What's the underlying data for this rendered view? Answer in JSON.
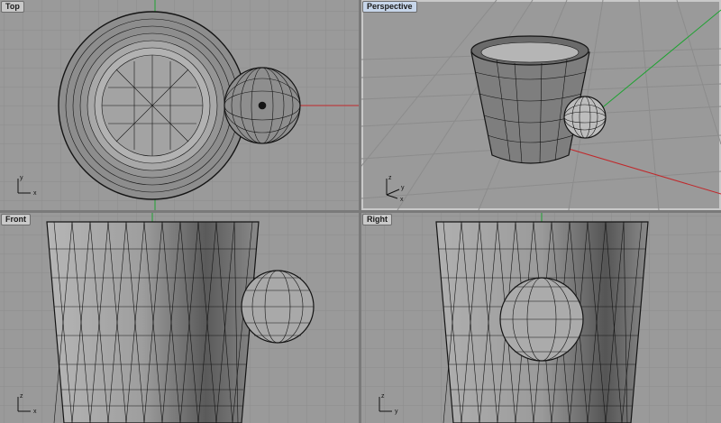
{
  "viewports": {
    "top": {
      "label": "Top",
      "axis_x": "x",
      "axis_y": "y"
    },
    "perspective": {
      "label": "Perspective",
      "axis_x": "x",
      "axis_y": "y",
      "axis_z": "z"
    },
    "front": {
      "label": "Front",
      "axis_x": "x",
      "axis_y": "z"
    },
    "right": {
      "label": "Right",
      "axis_x": "y",
      "axis_y": "z"
    }
  },
  "colors": {
    "viewport_bg": "#9a9a9a",
    "grid_line": "#8c8c8c",
    "x_axis": "#c0282b",
    "y_axis": "#1fa232",
    "active_tab": "#c7d6ea",
    "wire": "#141414"
  }
}
